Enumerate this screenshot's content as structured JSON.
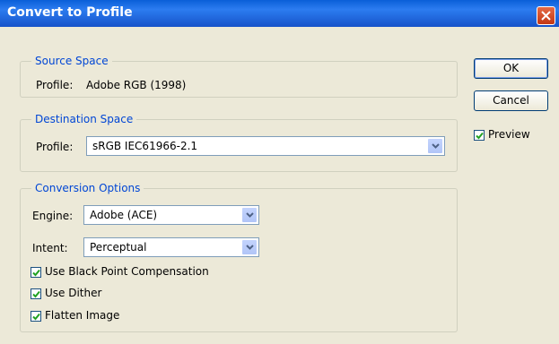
{
  "dialog": {
    "title": "Convert to Profile"
  },
  "source_space": {
    "legend": "Source Space",
    "profile_label": "Profile:",
    "profile_value": "Adobe RGB (1998)"
  },
  "destination_space": {
    "legend": "Destination Space",
    "profile_label": "Profile:",
    "profile_selected": "sRGB IEC61966-2.1"
  },
  "conversion_options": {
    "legend": "Conversion Options",
    "engine_label": "Engine:",
    "engine_selected": "Adobe (ACE)",
    "intent_label": "Intent:",
    "intent_selected": "Perceptual",
    "black_point_label": "Use Black Point Compensation",
    "black_point_checked": true,
    "dither_label": "Use Dither",
    "dither_checked": true,
    "flatten_label": "Flatten Image",
    "flatten_checked": true
  },
  "buttons": {
    "ok_label": "OK",
    "cancel_label": "Cancel"
  },
  "preview": {
    "label": "Preview",
    "checked": true
  },
  "colors": {
    "title_bar": "#0a5fd8",
    "legend_text": "#0046d5",
    "dialog_bg": "#ece9d8",
    "close_button": "#e56a45"
  },
  "icons": [
    "close-icon",
    "chevron-down-icon",
    "checkmark-icon"
  ]
}
